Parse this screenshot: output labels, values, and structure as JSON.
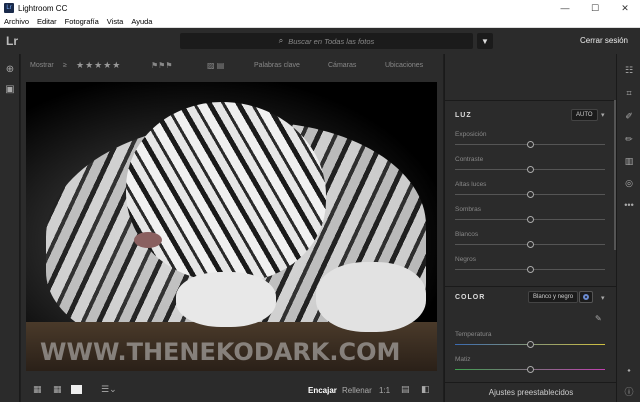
{
  "window": {
    "title": "Lightroom CC",
    "icon_text": "Lr",
    "minimize": "—",
    "maximize": "☐",
    "close": "✕"
  },
  "menu": [
    "Archivo",
    "Editar",
    "Fotografía",
    "Vista",
    "Ayuda"
  ],
  "header": {
    "logo": "Lr",
    "search_placeholder": "Buscar en Todas las fotos",
    "sign_out": "Cerrar sesión"
  },
  "filterbar": {
    "show_label": "Mostrar",
    "compare": "≥",
    "stars": "★★★★★",
    "keywords": "Palabras clave",
    "cameras": "Cámaras",
    "locations": "Ubicaciones"
  },
  "photo": {
    "watermark": "WWW.THENEKODARK.COM"
  },
  "bottombar": {
    "fit": "Encajar",
    "fill": "Rellenar",
    "ratio": "1:1"
  },
  "panel": {
    "light": {
      "title": "LUZ",
      "auto": "AUTO",
      "sliders": [
        {
          "label": "Exposición",
          "value": 0.5
        },
        {
          "label": "Contraste",
          "value": 0.5
        },
        {
          "label": "Altas luces",
          "value": 0.5
        },
        {
          "label": "Sombras",
          "value": 0.5
        },
        {
          "label": "Blancos",
          "value": 0.5
        },
        {
          "label": "Negros",
          "value": 0.5
        }
      ]
    },
    "color": {
      "title": "COLOR",
      "bw": "Blanco y negro",
      "sliders": [
        {
          "label": "Temperatura",
          "value": 0.5
        },
        {
          "label": "Matiz",
          "value": 0.5
        }
      ]
    },
    "presets": "Ajustes preestablecidos"
  },
  "colors": {
    "panel_bg": "#2b2b2b",
    "app_bg": "#1e1e1e"
  }
}
